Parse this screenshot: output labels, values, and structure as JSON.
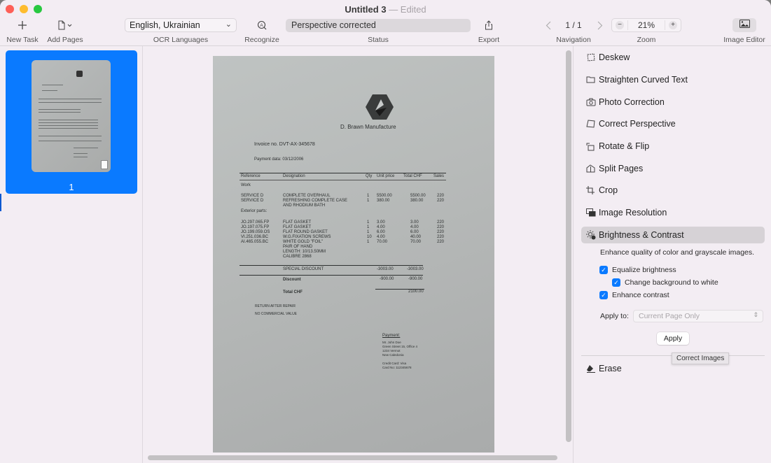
{
  "window": {
    "title": "Untitled 3",
    "title_suffix": "— Edited"
  },
  "toolbar": {
    "new_task": {
      "label": "New Task",
      "icon": "plus-icon"
    },
    "add_pages": {
      "label": "Add Pages",
      "icon": "document-icon"
    },
    "ocr_languages": {
      "label": "OCR Languages",
      "value": "English, Ukrainian"
    },
    "recognize": {
      "label": "Recognize",
      "icon": "recognize-icon"
    },
    "status": {
      "label": "Status",
      "value": "Perspective corrected"
    },
    "export": {
      "label": "Export",
      "icon": "share-icon"
    },
    "navigation": {
      "label": "Navigation",
      "page_indicator": "1 / 1"
    },
    "zoom": {
      "label": "Zoom",
      "value": "21%",
      "minus": "−",
      "plus": "+"
    },
    "image_editor": {
      "label": "Image Editor",
      "icon": "photo-icon"
    }
  },
  "sidebar": {
    "pages": [
      {
        "number": "1",
        "selected": true
      }
    ]
  },
  "document": {
    "company": "D. Brawn Manufacture",
    "invoice_no": "Invoice no. DVT-AX-345678",
    "payment_date": "Payment data: 03/12/2006",
    "columns": [
      "Reference",
      "Designation",
      "Qty",
      "Unit price",
      "Total CHF",
      "Sales"
    ],
    "section_work": "Work",
    "section_exterior": "Exterior parts:",
    "rows": [
      {
        "ref": "SERVICE D",
        "designation": "COMPLETE OVERHAUL",
        "qty": "1",
        "unit": "5500.00",
        "total": "5500.00",
        "sales": "220"
      },
      {
        "ref": "SERVICE D",
        "designation": "REFRESHING COMPLETE CASE",
        "qty": "1",
        "unit": "380.00",
        "total": "380.00",
        "sales": "220"
      },
      {
        "ref": "",
        "designation": "AND RHODIUM BATH",
        "qty": "",
        "unit": "",
        "total": "",
        "sales": ""
      },
      {
        "ref": "JO.297.065.FP",
        "designation": "FLAT GASKET",
        "qty": "1",
        "unit": "3.00",
        "total": "3.00",
        "sales": "220"
      },
      {
        "ref": "JO.197.075.FP",
        "designation": "FLAT GASKET",
        "qty": "1",
        "unit": "4.00",
        "total": "4.00",
        "sales": "220"
      },
      {
        "ref": "JO.199.059.OS",
        "designation": "FLAT ROUND GASKET",
        "qty": "1",
        "unit": "6.00",
        "total": "6.00",
        "sales": "220"
      },
      {
        "ref": "VI.251.036.BC",
        "designation": "W.G.FIXATION SCREWS",
        "qty": "10",
        "unit": "4.00",
        "total": "40.00",
        "sales": "220"
      },
      {
        "ref": "AI.465.055.BC",
        "designation": "WHITE GOLD \"FOIL\"",
        "qty": "1",
        "unit": "70.00",
        "total": "70.00",
        "sales": "220"
      },
      {
        "ref": "",
        "designation": "PAIR OF HAND",
        "qty": "",
        "unit": "",
        "total": "",
        "sales": ""
      },
      {
        "ref": "",
        "designation": "LENGTH: 10/13.50MM",
        "qty": "",
        "unit": "",
        "total": "",
        "sales": ""
      },
      {
        "ref": "",
        "designation": "CALIBRE 2868",
        "qty": "",
        "unit": "",
        "total": "",
        "sales": ""
      }
    ],
    "special_discount": {
      "label": "SPECIAL DISCOUNT",
      "unit": "-3003.00",
      "total": "-3003.00"
    },
    "discount": {
      "label": "Discount",
      "unit": "-900.00",
      "total": "-900.00"
    },
    "total": {
      "label": "Total CHF",
      "value": "2100.00"
    },
    "notes": [
      "RETURN AFTER REPAIR",
      "NO COMMERCIAL VALUE"
    ],
    "payment": {
      "heading": "Payment:",
      "lines": [
        "Mr. John Doe",
        "Green Street 15, Office 4",
        "1234 Vermot",
        "New Caledonia",
        "",
        "Credit Card: Visa",
        "Card No: 112345678"
      ]
    }
  },
  "panel": {
    "items": [
      {
        "label": "Deskew",
        "icon": "deskew-icon"
      },
      {
        "label": "Straighten Curved Text",
        "icon": "straighten-icon"
      },
      {
        "label": "Photo Correction",
        "icon": "camera-icon"
      },
      {
        "label": "Correct Perspective",
        "icon": "perspective-icon"
      },
      {
        "label": "Rotate & Flip",
        "icon": "rotate-icon"
      },
      {
        "label": "Split Pages",
        "icon": "split-pages-icon"
      },
      {
        "label": "Crop",
        "icon": "crop-icon"
      },
      {
        "label": "Image Resolution",
        "icon": "image-resolution-icon"
      },
      {
        "label": "Brightness & Contrast",
        "icon": "brightness-icon",
        "active": true
      }
    ],
    "brightness": {
      "description": "Enhance quality of color and grayscale images.",
      "equalize": {
        "label": "Equalize brightness",
        "checked": true
      },
      "background_white": {
        "label": "Change background to white",
        "checked": true
      },
      "enhance_contrast": {
        "label": "Enhance contrast",
        "checked": true
      },
      "apply_to_label": "Apply to:",
      "apply_to_value": "Current Page Only",
      "apply_button": "Apply",
      "tooltip": "Correct Images"
    },
    "erase": {
      "label": "Erase",
      "icon": "eraser-icon"
    }
  },
  "colors": {
    "accent": "#0a7aff",
    "window_bg": "#f3edf3",
    "active_item": "#d6d2d6"
  }
}
